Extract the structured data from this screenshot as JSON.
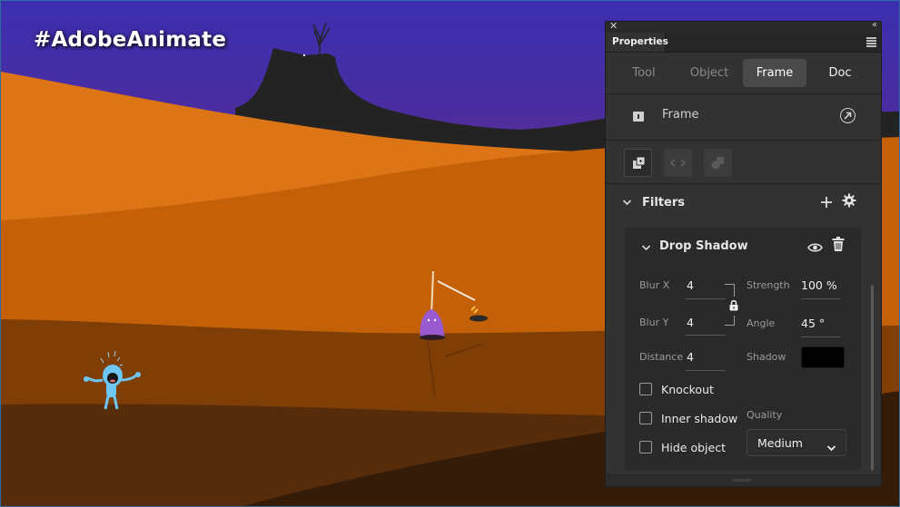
{
  "stage": {
    "hashtag": "#AdobeAnimate",
    "colors": {
      "sky_top": "#3b2fb0",
      "sky_bottom": "#5e2f8a",
      "mountain": "#232323",
      "dune_light": "#dd7416",
      "dune_mid": "#c46108",
      "dune_dark": "#7f3e06",
      "dune_darker": "#572c0a",
      "dune_darkest": "#341c08",
      "character_blue": "#6ec6f2",
      "character_purple": "#9a5ad0"
    }
  },
  "panel": {
    "title": "Properties",
    "tabs": [
      {
        "label": "Tool",
        "active": false
      },
      {
        "label": "Object",
        "active": false
      },
      {
        "label": "Frame",
        "active": true
      },
      {
        "label": "Doc",
        "active": false
      }
    ],
    "frame_section": {
      "label": "Frame"
    },
    "filters": {
      "label": "Filters",
      "drop_shadow": {
        "title": "Drop Shadow",
        "blur_x_label": "Blur X",
        "blur_x": "4",
        "blur_y_label": "Blur Y",
        "blur_y": "4",
        "strength_label": "Strength",
        "strength": "100 %",
        "angle_label": "Angle",
        "angle": "45 °",
        "distance_label": "Distance",
        "distance": "4",
        "shadow_label": "Shadow",
        "shadow_color": "#000000",
        "knockout_label": "Knockout",
        "knockout": false,
        "inner_shadow_label": "Inner shadow",
        "inner_shadow": false,
        "hide_object_label": "Hide object",
        "hide_object": false,
        "quality_label": "Quality",
        "quality": "Medium"
      }
    }
  }
}
